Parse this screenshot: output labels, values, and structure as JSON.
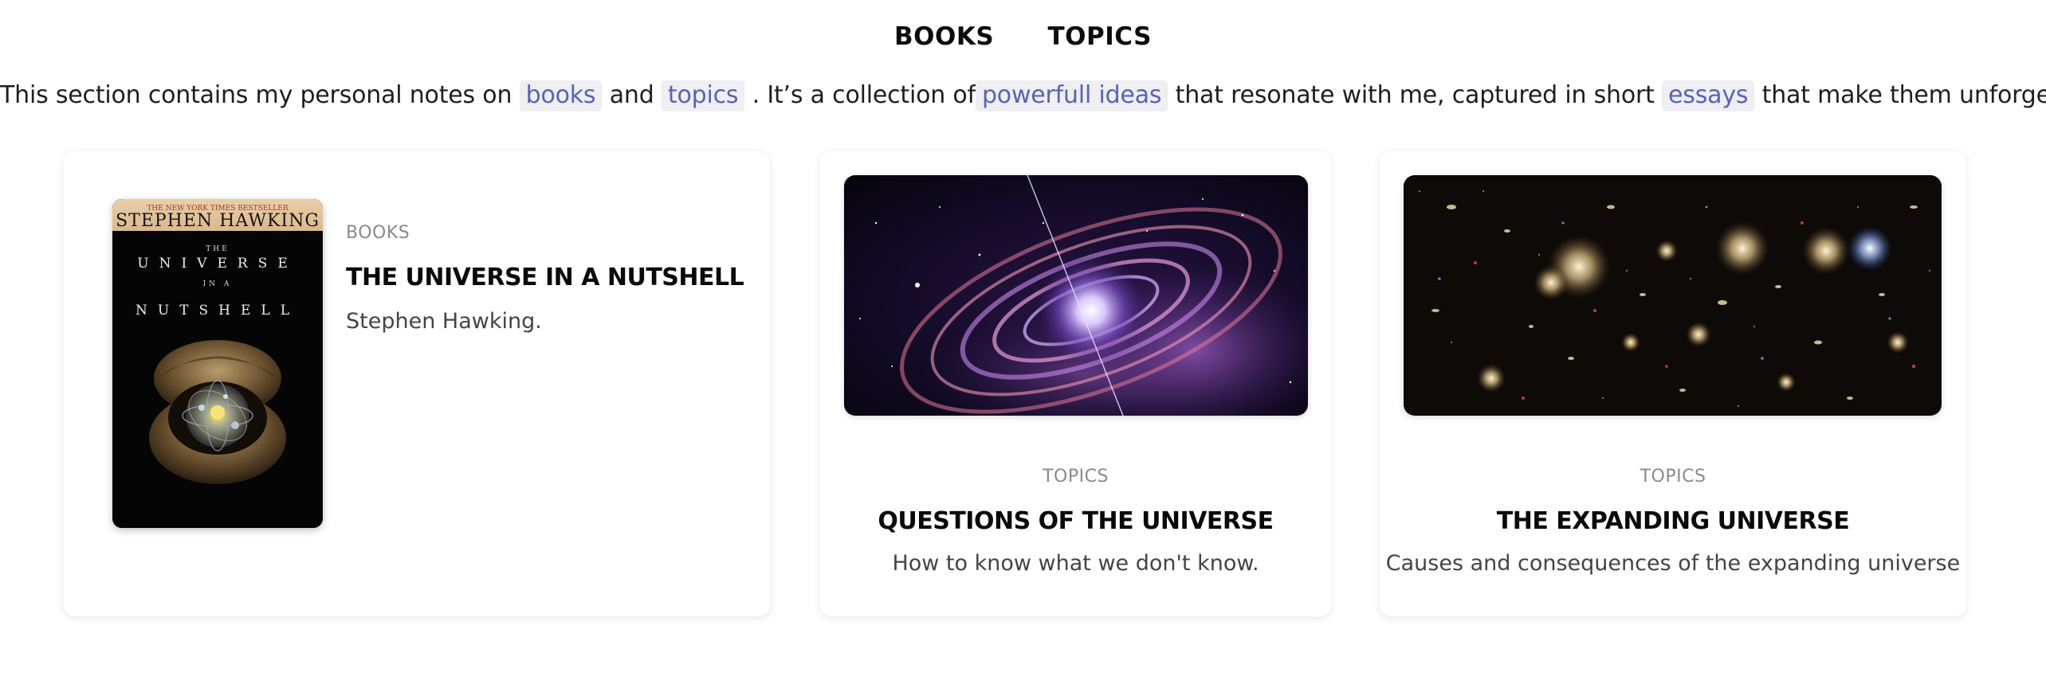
{
  "nav": {
    "items": [
      {
        "label": "BOOKS"
      },
      {
        "label": "TOPICS"
      }
    ]
  },
  "intro": {
    "t1": "This section contains my personal notes on ",
    "chip1": "books",
    "t2": " and ",
    "chip2": "topics",
    "t3": " . It’s a collection of",
    "chip3": "powerfull ideas",
    "t4": " that resonate with me, captured in short ",
    "chip4": "essays",
    "t5": " that make them unforgettable."
  },
  "cards": [
    {
      "kicker": "BOOKS",
      "title": "THE UNIVERSE IN A NUTSHELL",
      "desc": "Stephen Hawking.",
      "cover": {
        "banner": "THE NEW YORK TIMES BESTSELLER",
        "author": "STEPHEN HAWKING",
        "line1": "THE",
        "line2": "UNIVERSE",
        "line3": "IN A",
        "line4": "NUTSHELL"
      }
    },
    {
      "kicker": "TOPICS",
      "title": "QUESTIONS OF THE UNIVERSE",
      "desc": "How to know what we don't know."
    },
    {
      "kicker": "TOPICS",
      "title": "THE EXPANDING UNIVERSE",
      "desc": "Causes and consequences of the expanding universe"
    }
  ],
  "colors": {
    "chip_bg": "#eeeef3",
    "chip_text": "#5a63b0",
    "kicker": "#8a8a8a"
  }
}
